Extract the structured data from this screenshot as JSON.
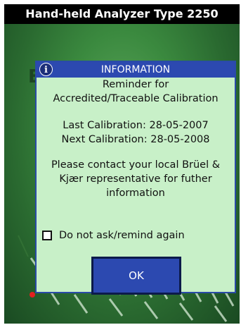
{
  "app": {
    "title": "Hand-held Analyzer Type 2250"
  },
  "background": {
    "partial_letter": "E"
  },
  "dialog": {
    "header": "INFORMATION",
    "info_icon": "i",
    "line1": "Reminder for",
    "line2": "Accredited/Traceable Calibration",
    "last_calibration": "Last Calibration: 28-05-2007",
    "next_calibration": "Next Calibration: 28-05-2008",
    "contact_line1": "Please contact your local Brüel &",
    "contact_line2": "Kjær representative for futher",
    "contact_line3": "information",
    "checkbox_label": "Do not ask/remind again",
    "checkbox_checked": false,
    "ok_label": "OK"
  },
  "colors": {
    "dialog_header": "#2c49b0",
    "dialog_body": "#c8f0c8",
    "ok_button": "#2c49b0",
    "splash_green": "#3b8a3f"
  }
}
